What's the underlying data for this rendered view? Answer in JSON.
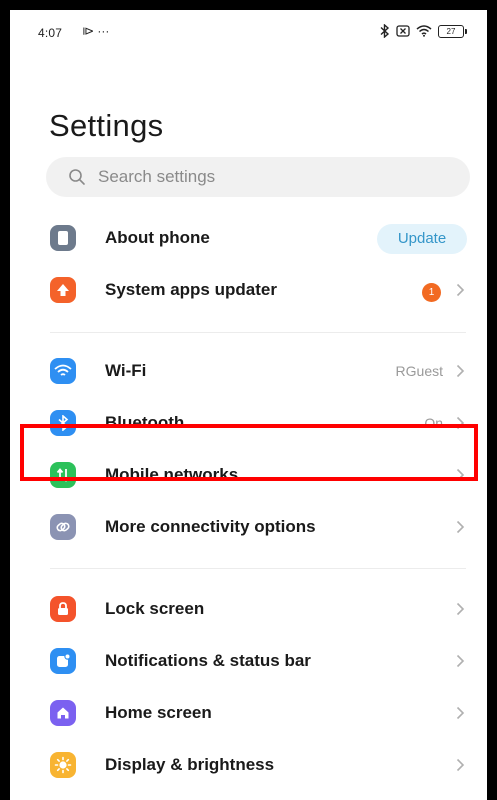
{
  "status_bar": {
    "time": "4:07",
    "left_icons": "⧐ ···",
    "battery_level": "27"
  },
  "page": {
    "title": "Settings"
  },
  "search": {
    "placeholder": "Search settings"
  },
  "groups": [
    {
      "items": [
        {
          "label": "About phone",
          "icon": "phone-icon",
          "icon_color": "#6d7a8c",
          "action_label": "Update"
        },
        {
          "label": "System apps updater",
          "icon": "arrow-up-icon",
          "icon_color": "#f4622a",
          "badge": "1"
        }
      ]
    },
    {
      "items": [
        {
          "label": "Wi-Fi",
          "icon": "wifi-icon",
          "icon_color": "#2e8ff2",
          "value": "RGuest"
        },
        {
          "label": "Bluetooth",
          "icon": "bluetooth-icon",
          "icon_color": "#2e8ff2",
          "value": "On"
        },
        {
          "label": "Mobile networks",
          "icon": "mobile-data-icon",
          "icon_color": "#2cc15a",
          "highlighted": true
        },
        {
          "label": "More connectivity options",
          "icon": "link-icon",
          "icon_color": "#8b93b3"
        }
      ]
    },
    {
      "items": [
        {
          "label": "Lock screen",
          "icon": "lock-icon",
          "icon_color": "#f4532b"
        },
        {
          "label": "Notifications & status bar",
          "icon": "notification-icon",
          "icon_color": "#2e8ff2"
        },
        {
          "label": "Home screen",
          "icon": "home-icon",
          "icon_color": "#7b61f0"
        },
        {
          "label": "Display & brightness",
          "icon": "sun-icon",
          "icon_color": "#f8b432"
        }
      ]
    }
  ],
  "colors": {
    "highlight_border": "#ff0000",
    "update_pill_bg": "#e3f3fb",
    "update_pill_text": "#3496c9",
    "badge": "#f26a22"
  }
}
